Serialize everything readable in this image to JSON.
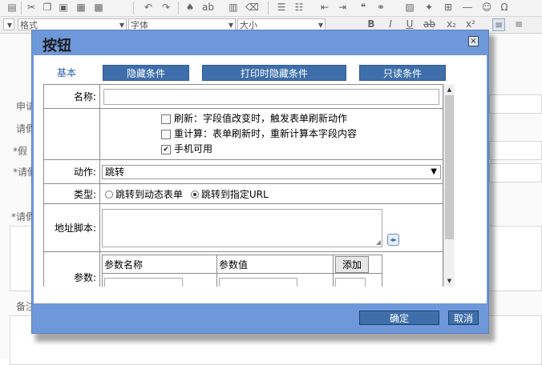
{
  "toolbar": {
    "format_label": "格式",
    "font_label": "字体",
    "size_label": "大小",
    "icons": [
      "document-icon",
      "cut-icon",
      "copy-icon",
      "paste-icon",
      "paste-text-icon",
      "paste-word-icon",
      "undo-icon",
      "redo-icon",
      "find-icon",
      "replace-icon",
      "select-all-icon",
      "eraser-icon",
      "ordered-list-icon",
      "bullet-list-icon",
      "outdent-icon",
      "indent-icon",
      "quote-icon",
      "link-icon",
      "image-icon",
      "flash-icon",
      "table-icon",
      "hr-icon",
      "smiley-icon",
      "special-char-icon"
    ],
    "format_icons": [
      "bold-icon",
      "italic-icon",
      "underline-icon",
      "strike-icon",
      "subscript-icon",
      "superscript-icon",
      "align-left-icon",
      "align-center-icon"
    ]
  },
  "background": {
    "rows": [
      "申请",
      "请假",
      "*假",
      "*请假",
      "*请假",
      "备注"
    ]
  },
  "dialog": {
    "title": "按钮",
    "close_glyph": "×",
    "tabs": [
      {
        "label": "基本",
        "active": true
      },
      {
        "label": "隐藏条件",
        "active": false
      },
      {
        "label": "打印时隐藏条件",
        "active": false
      },
      {
        "label": "只读条件",
        "active": false
      }
    ],
    "form": {
      "name_label": "名称:",
      "name_value": "",
      "options": [
        {
          "label": "刷新：字段值改变时，触发表单刷新动作",
          "checked": false
        },
        {
          "label": "重计算：表单刷新时，重新计算本字段内容",
          "checked": false
        },
        {
          "label": "手机可用",
          "checked": true
        }
      ],
      "action_label": "动作:",
      "action_value": "跳转",
      "type_label": "类型:",
      "type_options": [
        {
          "label": "跳转到动态表单",
          "selected": false
        },
        {
          "label": "跳转到指定URL",
          "selected": true
        }
      ],
      "script_label": "地址脚本:",
      "params_label": "参数:",
      "param_headers": [
        "参数名称",
        "参数值"
      ],
      "add_label": "添加"
    },
    "footer": {
      "ok_label": "确定",
      "cancel_label": "取消"
    }
  }
}
